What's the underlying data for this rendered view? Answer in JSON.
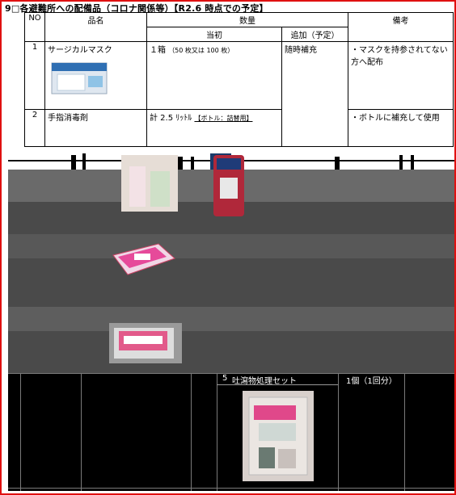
{
  "title": "9□各避難所への配備品（コロナ関係等）【R2.6 時点での予定】",
  "headers": {
    "no": "NO",
    "item": "品名",
    "quantity": "数量",
    "initial": "当初",
    "additional": "追加（予定）",
    "remarks": "備考"
  },
  "rows": [
    {
      "no": "1",
      "item": "サージカルマスク",
      "initial": "１箱",
      "initial_note": "（50 枚又は 100 枚）",
      "additional": "随時補充",
      "remarks": "・マスクを持参されてない方へ配布"
    },
    {
      "no": "2",
      "item": "手指消毒剤",
      "initial": "計 2.5 ﾘｯﾄﾙ",
      "initial_note": "【ボトル：詰替用】",
      "additional": "",
      "remarks": "・ボトルに補充して使用"
    },
    {
      "no": "5",
      "item": "吐瀉物処理セット",
      "initial": "1個（1回分）",
      "initial_note": "",
      "additional": "",
      "remarks": ""
    }
  ],
  "colors": {
    "frame": "#e01010"
  },
  "icons": [
    "mask-box-photo",
    "sanitizer-bottle-photo",
    "gloves-box-photo",
    "paper-towel-photo",
    "vomit-kit-photo"
  ]
}
